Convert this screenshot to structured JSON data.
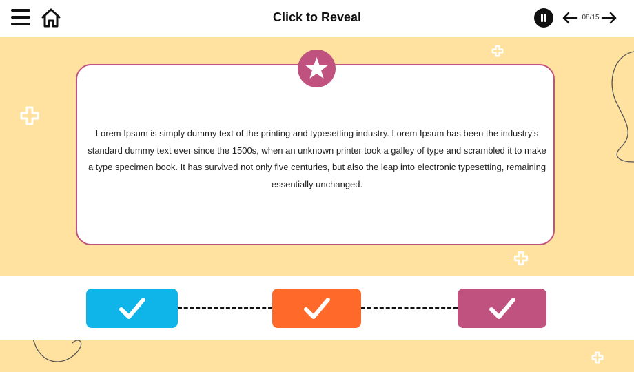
{
  "header": {
    "title": "Click to Reveal",
    "counter": "08/15"
  },
  "icons": {
    "menu": "menu-icon",
    "home": "home-icon",
    "pause": "pause-icon",
    "prev": "arrow-left-icon",
    "next": "arrow-right-icon",
    "star": "star-icon",
    "check": "checkmark-icon"
  },
  "card": {
    "text": "Lorem Ipsum is simply dummy text of the printing and typesetting industry. Lorem Ipsum has been the industry's standard dummy text ever since the 1500s, when an unknown printer took a galley of type and scrambled it to make a type specimen book. It has survived not only five centuries, but also the leap into electronic typesetting, remaining essentially unchanged."
  },
  "buttons": [
    {
      "color": "#0fb5e8"
    },
    {
      "color": "#ff6a2a"
    },
    {
      "color": "#c0527f"
    }
  ],
  "colors": {
    "background": "#ffe2a0",
    "accent": "#c0527f",
    "text": "#111111"
  }
}
